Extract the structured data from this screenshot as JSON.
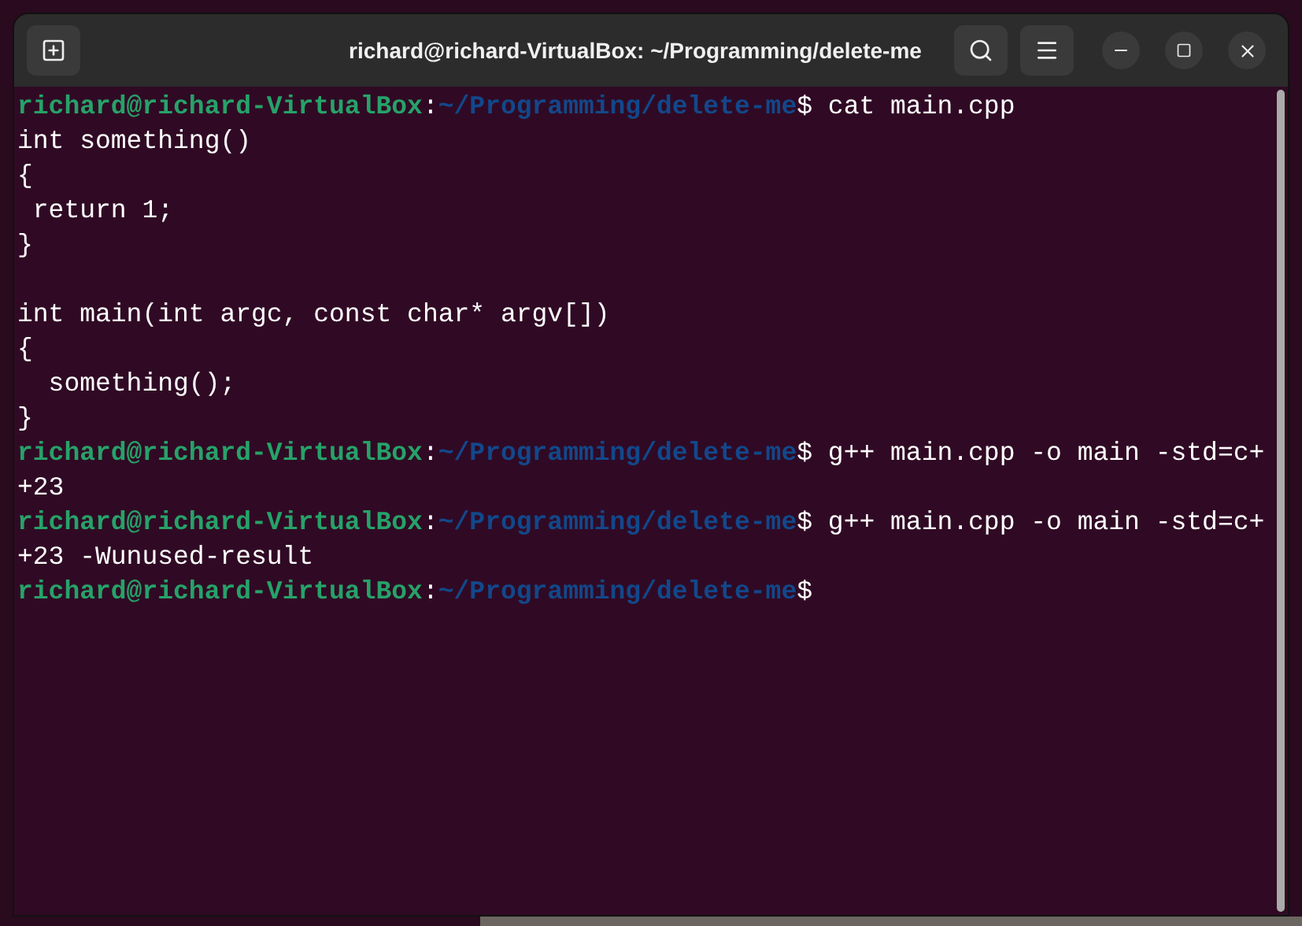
{
  "window": {
    "title": "richard@richard-VirtualBox: ~/Programming/delete-me"
  },
  "terminal": {
    "lines": [
      [
        {
          "kind": "user",
          "text": "richard@richard-VirtualBox"
        },
        {
          "kind": "plain",
          "text": ":"
        },
        {
          "kind": "path",
          "text": "~/Programming/delete-me"
        },
        {
          "kind": "plain",
          "text": "$ cat main.cpp"
        }
      ],
      [
        {
          "kind": "plain",
          "text": "int something()"
        }
      ],
      [
        {
          "kind": "plain",
          "text": "{"
        }
      ],
      [
        {
          "kind": "plain",
          "text": " return 1;"
        }
      ],
      [
        {
          "kind": "plain",
          "text": "}"
        }
      ],
      [
        {
          "kind": "blank"
        }
      ],
      [
        {
          "kind": "plain",
          "text": "int main(int argc, const char* argv[])"
        }
      ],
      [
        {
          "kind": "plain",
          "text": "{"
        }
      ],
      [
        {
          "kind": "plain",
          "text": "  something();"
        }
      ],
      [
        {
          "kind": "plain",
          "text": "}"
        }
      ],
      [
        {
          "kind": "user",
          "text": "richard@richard-VirtualBox"
        },
        {
          "kind": "plain",
          "text": ":"
        },
        {
          "kind": "path",
          "text": "~/Programming/delete-me"
        },
        {
          "kind": "plain",
          "text": "$ g++ main.cpp -o main -std=c+"
        }
      ],
      [
        {
          "kind": "plain",
          "text": "+23"
        }
      ],
      [
        {
          "kind": "user",
          "text": "richard@richard-VirtualBox"
        },
        {
          "kind": "plain",
          "text": ":"
        },
        {
          "kind": "path",
          "text": "~/Programming/delete-me"
        },
        {
          "kind": "plain",
          "text": "$ g++ main.cpp -o main -std=c+"
        }
      ],
      [
        {
          "kind": "plain",
          "text": "+23 -Wunused-result"
        }
      ],
      [
        {
          "kind": "user",
          "text": "richard@richard-VirtualBox"
        },
        {
          "kind": "plain",
          "text": ":"
        },
        {
          "kind": "path",
          "text": "~/Programming/delete-me"
        },
        {
          "kind": "plain",
          "text": "$"
        }
      ]
    ]
  }
}
